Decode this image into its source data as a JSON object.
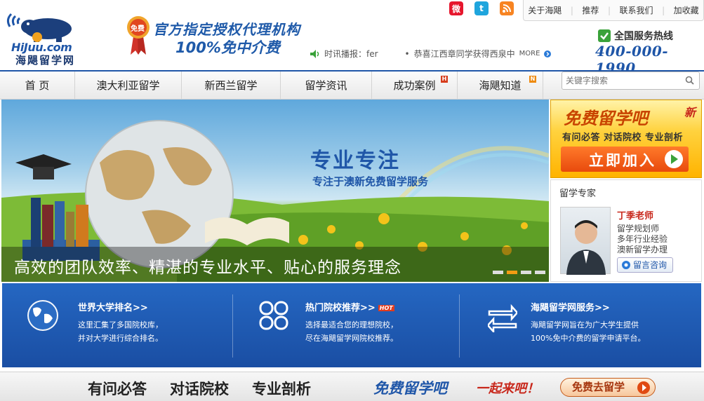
{
  "header": {
    "logo_en": "HiJuu.com",
    "logo_cn": "海飓留学网",
    "badge_text": "免费",
    "slogan_line1": "官方指定授权代理机构",
    "slogan_line2": "100%免中介费",
    "news_label": "时讯播报：fer",
    "news_item": "恭喜江西章同学获得西泉中",
    "news_more": "MORE",
    "hotline_label": "全国服务热线",
    "hotline_number": "400-000-1990"
  },
  "top_links": [
    {
      "label": "关于海飓"
    },
    {
      "label": "推荐"
    },
    {
      "label": "联系我们"
    },
    {
      "label": "加收藏"
    }
  ],
  "nav": {
    "items": [
      {
        "label": "首 页"
      },
      {
        "label": "澳大利亚留学"
      },
      {
        "label": "新西兰留学"
      },
      {
        "label": "留学资讯"
      },
      {
        "label": "成功案例",
        "badge": "H"
      },
      {
        "label": "海飓知道",
        "badge": "N"
      }
    ],
    "search_placeholder": "关键字搜索"
  },
  "banner": {
    "title": "专业专注",
    "subtitle": "专注于澳新免费留学服务",
    "caption": "高效的团队效率、精湛的专业水平、贴心的服务理念",
    "slide_count": 4,
    "active_slide": 2
  },
  "sidebar": {
    "join_title": "免费留学吧",
    "join_new": "新",
    "join_sub": "有问必答  对话院校  专业剖析",
    "join_button": "立即加入",
    "expert_heading": "留学专家",
    "expert_name": "丁季老师",
    "expert_lines": [
      "留学规划师",
      "多年行业经验",
      "澳新留学办理"
    ],
    "expert_button": "留言咨询"
  },
  "features": [
    {
      "title": "世界大学排名>>",
      "desc1": "这里汇集了多国院校库，",
      "desc2": "并对大学进行综合排名。",
      "icon": "globe-icon"
    },
    {
      "title": "热门院校推荐>>",
      "hot": "HOT",
      "desc1": "选择最适合您的理想院校，",
      "desc2": "尽在海飓留学网院校推荐。",
      "icon": "clover-icon"
    },
    {
      "title": "海飓留学网服务>>",
      "desc1": "海飓留学网旨在为广大学生提供",
      "desc2": "100%免中介费的留学申请平台。",
      "icon": "exchange-arrows-icon"
    }
  ],
  "bottom_bar": {
    "items": [
      "有问必答",
      "对话院校",
      "专业剖析"
    ],
    "free_label": "免费留学吧",
    "together": "一起来吧！",
    "button": "免费去留学"
  },
  "colors": {
    "brand_blue": "#1f56a8",
    "accent_orange": "#f39c12",
    "band_blue": "#2567c2",
    "hot_red": "#c8281c"
  }
}
